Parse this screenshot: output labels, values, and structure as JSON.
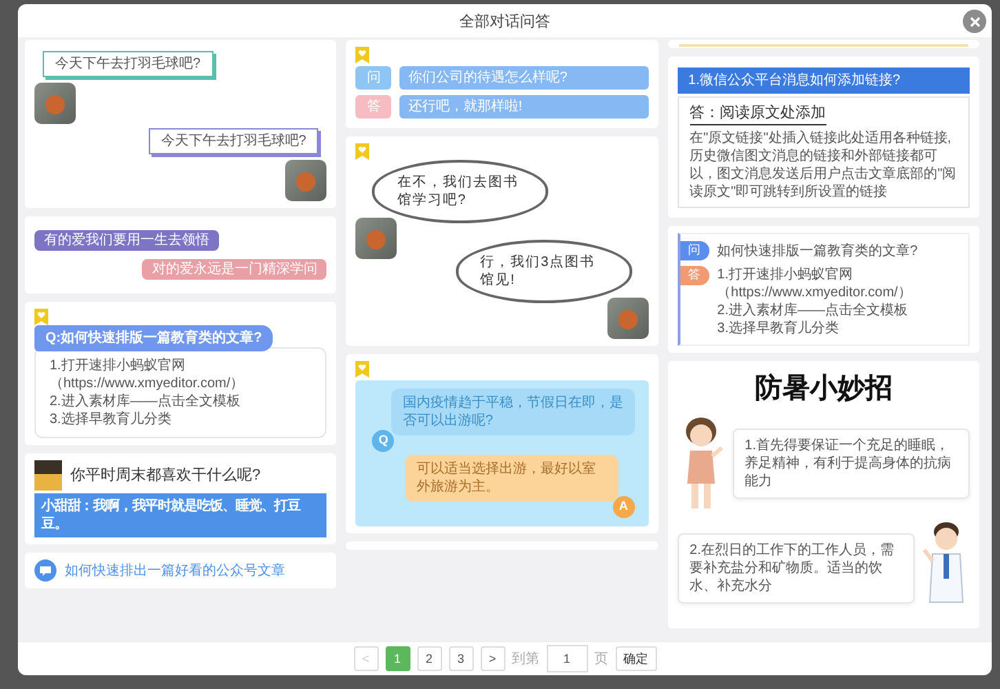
{
  "dialog": {
    "title": "全部对话问答"
  },
  "columns": [
    {
      "cards": [
        {
          "kind": "photo_chat",
          "messages": [
            {
              "text": "今天下午去打羽毛球吧?",
              "outgoing": false
            },
            {
              "text": "今天下午去打羽毛球吧?",
              "outgoing": true
            }
          ]
        },
        {
          "kind": "pill_chat",
          "messages": [
            {
              "text": "有的爱我们要用一生去领悟",
              "outgoing": false,
              "color": "#7d74c4"
            },
            {
              "text": "对的爱永远是一门精深学问",
              "outgoing": true,
              "color": "#e8a0a6"
            }
          ]
        },
        {
          "kind": "qa_steps",
          "question": "Q:如何快速排版一篇教育类的文章?",
          "steps": [
            "1.打开速排小蚂蚁官网",
            "（https://www.xmyeditor.com/）",
            "2.进入素材库——点击全文模板",
            "3.选择早教育儿分类"
          ]
        },
        {
          "kind": "avatar_chat",
          "question": "你平时周末都喜欢干什么呢?",
          "reply": "小甜甜：我啊，我平时就是吃饭、睡觉、打豆豆。"
        },
        {
          "kind": "link_item",
          "text": "如何快速排出一篇好看的公众号文章"
        }
      ]
    },
    {
      "cards": [
        {
          "kind": "ask_answer",
          "rows": [
            {
              "tag": "问",
              "text": "你们公司的待遇怎么样呢?",
              "color": "#8ec5f3"
            },
            {
              "tag": "答",
              "text": "还行吧，就那样啦!",
              "color": "#f6bcc2"
            }
          ]
        },
        {
          "kind": "cloud_chat",
          "messages": [
            {
              "text": "在不，我们去图书馆学习吧?",
              "outgoing": false
            },
            {
              "text": "行，我们3点图书馆见!",
              "outgoing": true
            }
          ]
        },
        {
          "kind": "bubble_qa",
          "question": {
            "badge": "Q",
            "text": "国内疫情趋于平稳，节假日在即，是否可以出游呢?"
          },
          "answer": {
            "badge": "A",
            "text": "可以适当选择出游，最好以室外旅游为主。"
          }
        },
        {
          "kind": "cut_off"
        }
      ]
    },
    {
      "cards": [
        {
          "kind": "cut_off"
        },
        {
          "kind": "heading_answer",
          "heading": "1.微信公众平台消息如何添加链接?",
          "answer_title": "答：阅读原文处添加",
          "body": "在\"原文链接\"处插入链接此处适用各种链接,历史微信图文消息的链接和外部链接都可以，图文消息发送后用户点击文章底部的\"阅读原文\"即可跳转到所设置的链接"
        },
        {
          "kind": "tag_list",
          "question": {
            "tag": "问",
            "text": "如何快速排版一篇教育类的文章?",
            "color": "#5b8def"
          },
          "answer": {
            "tag": "答",
            "color": "#f29a72",
            "steps": [
              "1.打开速排小蚂蚁官网",
              "（https://www.xmyeditor.com/）",
              "2.进入素材库——点击全文模板",
              "3.选择早教育儿分类"
            ]
          }
        },
        {
          "kind": "tips",
          "title": "防暑小妙招",
          "tips": [
            {
              "kind": "woman",
              "text": "1.首先得要保证一个充足的睡眠，养足精神，有利于提高身体的抗病能力"
            },
            {
              "kind": "doctor",
              "text": "2.在烈日的工作下的工作人员，需要补充盐分和矿物质。适当的饮水、补充水分"
            }
          ]
        }
      ]
    }
  ],
  "pager": {
    "prev": {
      "label": "<",
      "disabled": true
    },
    "pages": [
      {
        "label": "1",
        "selected": true
      },
      {
        "label": "2",
        "selected": false
      },
      {
        "label": "3",
        "selected": false
      }
    ],
    "next": {
      "label": ">",
      "disabled": false
    },
    "goto_label": "到第",
    "page_input": "1",
    "unit": "页",
    "confirm": "确定"
  }
}
